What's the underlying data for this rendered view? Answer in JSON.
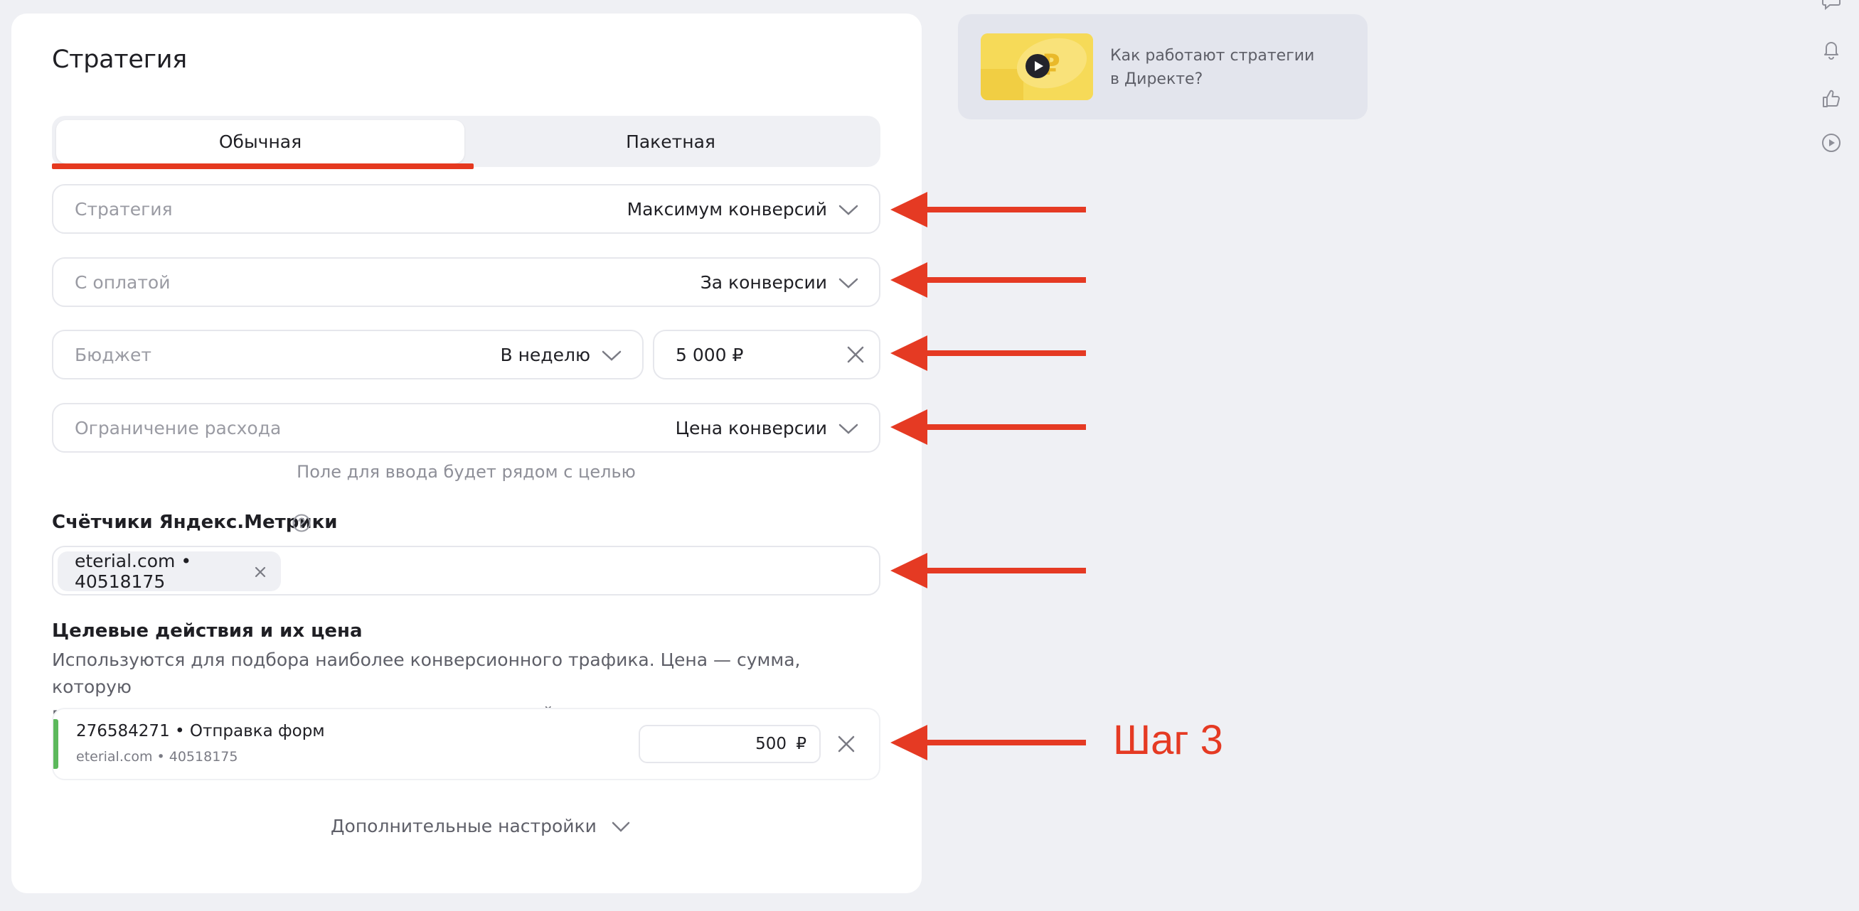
{
  "strategy": {
    "title": "Стратегия",
    "tabs": [
      "Обычная",
      "Пакетная"
    ],
    "fields": {
      "strategy": {
        "label": "Стратегия",
        "value": "Максимум конверсий"
      },
      "payment": {
        "label": "С оплатой",
        "value": "За конверсии"
      },
      "budget": {
        "label": "Бюджет",
        "period": "В неделю",
        "amount": "5 000 ₽"
      },
      "limit": {
        "label": "Ограничение расхода",
        "value": "Цена конверсии"
      }
    },
    "hint": "Поле для ввода будет рядом с целью"
  },
  "metrika": {
    "title": "Счётчики Яндекс.Метрики",
    "chip": "eterial.com • 40518175"
  },
  "goals": {
    "title": "Целевые действия и их цена",
    "description_line1": "Используются для подбора наиболее конверсионного трафика. Цена — сумма, которую",
    "description_line2": "вы готовы платить за достижение посетителем этой цели.",
    "items": [
      {
        "name": "276584271 • Отправка форм",
        "counter": "eterial.com • 40518175",
        "price": "500",
        "currency": "₽",
        "accent_color": "#5cb85c"
      }
    ]
  },
  "more_settings": "Дополнительные настройки",
  "promo": {
    "line1": "Как работают стратегии",
    "line2": "в Директе?"
  },
  "annotation": {
    "step_label": "Шаг 3",
    "color": "#e53a23"
  },
  "side_icons": [
    "chat-icon",
    "bell-icon",
    "thumbs-up-icon",
    "play-icon"
  ]
}
